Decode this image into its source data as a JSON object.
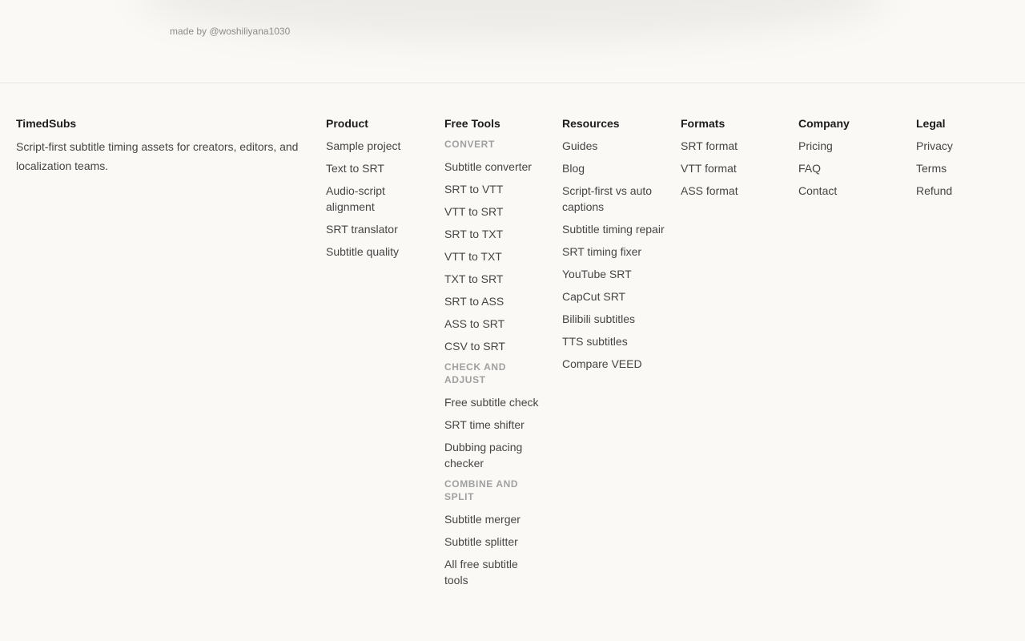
{
  "top": {
    "made_by": "made by @woshiliyana1030"
  },
  "brand": {
    "name": "TimedSubs",
    "description": "Script-first subtitle timing assets for creators, editors, and localization teams."
  },
  "product": {
    "title": "Product",
    "links": [
      "Sample project",
      "Text to SRT",
      "Audio-script alignment",
      "SRT translator",
      "Subtitle quality"
    ]
  },
  "free_tools": {
    "title": "Free Tools",
    "groups": [
      {
        "label": "CONVERT",
        "links": [
          "Subtitle converter",
          "SRT to VTT",
          "VTT to SRT",
          "SRT to TXT",
          "VTT to TXT",
          "TXT to SRT",
          "SRT to ASS",
          "ASS to SRT",
          "CSV to SRT"
        ]
      },
      {
        "label": "CHECK AND ADJUST",
        "links": [
          "Free subtitle check",
          "SRT time shifter",
          "Dubbing pacing checker"
        ]
      },
      {
        "label": "COMBINE AND SPLIT",
        "links": [
          "Subtitle merger",
          "Subtitle splitter",
          "All free subtitle tools"
        ]
      }
    ]
  },
  "resources": {
    "title": "Resources",
    "links": [
      "Guides",
      "Blog",
      "Script-first vs auto captions",
      "Subtitle timing repair",
      "SRT timing fixer",
      "YouTube SRT",
      "CapCut SRT",
      "Bilibili subtitles",
      "TTS subtitles",
      "Compare VEED"
    ]
  },
  "formats": {
    "title": "Formats",
    "links": [
      "SRT format",
      "VTT format",
      "ASS format"
    ]
  },
  "company": {
    "title": "Company",
    "links": [
      "Pricing",
      "FAQ",
      "Contact"
    ]
  },
  "legal": {
    "title": "Legal",
    "links": [
      "Privacy",
      "Terms",
      "Refund"
    ]
  }
}
